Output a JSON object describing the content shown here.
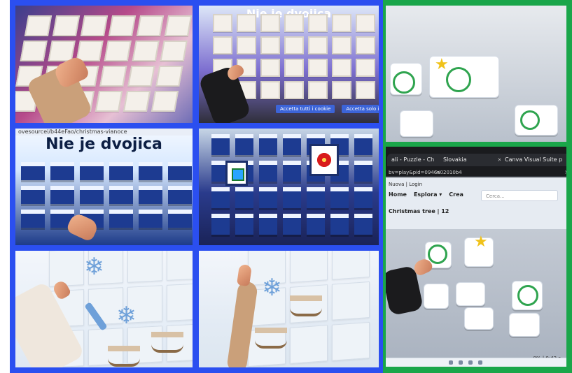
{
  "collage": {
    "colors": {
      "blue_frame": "#2b4ff0",
      "green_frame": "#1aa64a"
    },
    "panels": [
      {
        "id": "panel-1"
      },
      {
        "id": "panel-2",
        "title": "Nie je dvojica",
        "buttons": [
          "Accetta tutti i cookie",
          "Accetta solo i cookie essenz"
        ]
      },
      {
        "id": "panel-3",
        "url_text": "ovesourcei/b44eFao/christmas-vianoce",
        "title": "Nie je dvojica"
      },
      {
        "id": "panel-4"
      },
      {
        "id": "panel-5"
      },
      {
        "id": "panel-6"
      },
      {
        "id": "panel-7"
      },
      {
        "id": "panel-8",
        "tabs": [
          "ali - Puzzle - Ch",
          "Slovakia",
          "Canva Visual Suite p"
        ],
        "address_text": "bv=play&pid=0946a02010b4",
        "crumb_text": "Nuova | Login",
        "menu": [
          "Home",
          "Esplora ▾",
          "Crea"
        ],
        "search_placeholder": "Cerca...",
        "puzzle_title": "Christmas tree | 12",
        "status_text": "0% | 0:43 s"
      }
    ]
  }
}
